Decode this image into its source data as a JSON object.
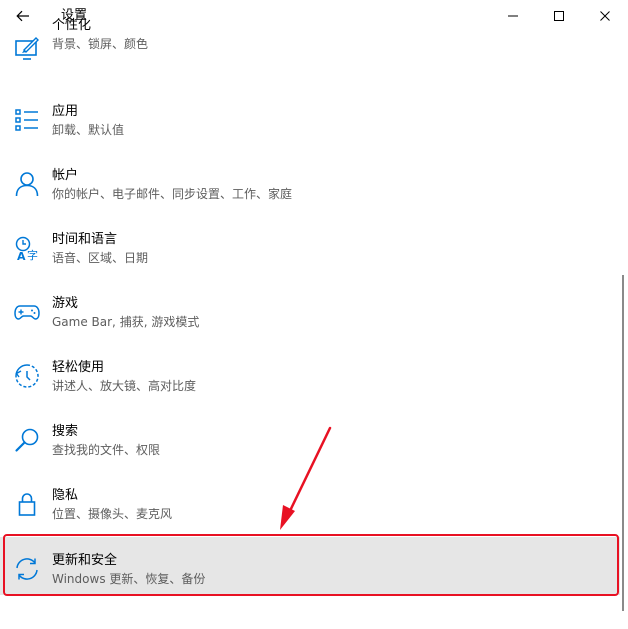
{
  "window": {
    "title": "设置",
    "back_icon": "arrow-left-icon",
    "minimize_icon": "minimize-icon",
    "maximize_icon": "maximize-icon",
    "close_icon": "close-icon"
  },
  "accent_color": "#0078d7",
  "highlight_color": "#e81123",
  "settings": [
    {
      "title": "个性化",
      "desc": "背景、锁屏、颜色",
      "icon": "personalization-icon"
    },
    {
      "title": "应用",
      "desc": "卸载、默认值",
      "icon": "apps-icon"
    },
    {
      "title": "帐户",
      "desc": "你的帐户、电子邮件、同步设置、工作、家庭",
      "icon": "account-icon"
    },
    {
      "title": "时间和语言",
      "desc": "语音、区域、日期",
      "icon": "time-language-icon"
    },
    {
      "title": "游戏",
      "desc": "Game Bar, 捕获, 游戏模式",
      "icon": "gaming-icon"
    },
    {
      "title": "轻松使用",
      "desc": "讲述人、放大镜、高对比度",
      "icon": "ease-of-access-icon"
    },
    {
      "title": "搜索",
      "desc": "查找我的文件、权限",
      "icon": "search-icon"
    },
    {
      "title": "隐私",
      "desc": "位置、摄像头、麦克风",
      "icon": "privacy-lock-icon"
    },
    {
      "title": "更新和安全",
      "desc": "Windows 更新、恢复、备份",
      "icon": "update-security-icon"
    }
  ]
}
